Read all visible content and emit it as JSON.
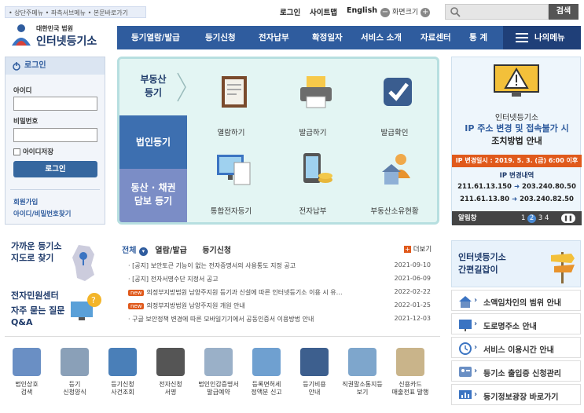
{
  "header": {
    "skip_links": "• 상단주메뉴 • 좌측서브메뉴 • 본문바로가기",
    "login": "로그인",
    "sitemap": "사이트맵",
    "english": "English",
    "zoom_minus": "−",
    "zoom_label": "화면크기",
    "zoom_plus": "+",
    "search_placeholder": "",
    "search_button": "검색",
    "logo_small": "대한민국 법원",
    "logo_main": "인터넷등기소"
  },
  "nav": {
    "items": [
      "등기열람/발급",
      "등기신청",
      "전자납부",
      "확정일자",
      "서비스 소개",
      "자료센터",
      "통 계"
    ],
    "my_menu": "나의메뉴"
  },
  "login_box": {
    "title": "로그인",
    "id_label": "아이디",
    "pw_label": "비밀번호",
    "save_id": "아이디저장",
    "login_button": "로그인",
    "join": "회원가입",
    "find": "아이디/비밀번호찾기"
  },
  "center": {
    "side_tabs": [
      "부동산\n등기",
      "법인등기",
      "동산 · 채권\n담보 등기"
    ],
    "tiles": [
      "열람하기",
      "발급하기",
      "발급확인",
      "통합전자등기",
      "전자납부",
      "부동산소유현황"
    ]
  },
  "banner": {
    "line1": "인터넷등기소",
    "line2": "IP 주소 변경 및 접속불가 시",
    "line3": "조치방법 안내",
    "date": "IP 변경일시 : 2019. 5. 3. (금) 6:00 이후",
    "detail_title": "IP 변경내역",
    "row1_old": "211.61.13.150",
    "row1_new": "203.240.80.50",
    "row2_old": "211.61.13.80",
    "row2_new": "203.240.82.50",
    "bar_label": "알림창",
    "pages": [
      "1",
      "2",
      "3",
      "4"
    ]
  },
  "guides": {
    "g1_line1": "가까운 등기소",
    "g1_line2": "지도로 찾기",
    "g2_line1": "전자민원센터",
    "g2_line2": "자주 묻는 질문",
    "g2_line3": "Q&A"
  },
  "news": {
    "tabs": [
      "전체",
      "열람/발급",
      "등기신청"
    ],
    "more": "더보기",
    "new_badge": "new",
    "items": [
      {
        "title": "· [공지] 보안토큰 기능이 없는 전자증명서의 사용통도 지정 공고",
        "date": "2021-09-10",
        "new": false
      },
      {
        "title": "· [공지] 전자서명수단 지정서 공고",
        "date": "2021-06-09",
        "new": false
      },
      {
        "title": "의정부지방법원 남양주지원 등기과 신설에 따른 인터넷등기소 이용 시 유…",
        "date": "2022-02-22",
        "new": true
      },
      {
        "title": "의정부지방법원 남양주지원 개원 안내",
        "date": "2022-01-25",
        "new": true
      },
      {
        "title": "· 구글 보안정책 변경에 따른 모바일기기에서 공동인증서 이용방법 안내",
        "date": "2021-12-03",
        "new": false
      }
    ]
  },
  "bottom_icons": [
    {
      "label": "법인상호\n검색",
      "color": "#6a8fc4"
    },
    {
      "label": "등기\n신청양식",
      "color": "#8aa0b8"
    },
    {
      "label": "등기신청\n사건조회",
      "color": "#4a7fb8"
    },
    {
      "label": "전자신청\n서명",
      "color": "#555555"
    },
    {
      "label": "법인인감증명서\n발급예약",
      "color": "#9ab0c8"
    },
    {
      "label": "등록면허세\n정액분 신고",
      "color": "#6fa0d0"
    },
    {
      "label": "등기비용\n안내",
      "color": "#3d5f8e"
    },
    {
      "label": "직권말소통지등\n보기",
      "color": "#7ea6cc"
    },
    {
      "label": "신용카드\n매출전표 발행",
      "color": "#c9b48a"
    }
  ],
  "right_side": {
    "shortcut_title1": "인터넷등기소",
    "shortcut_title2": "간편길잡이",
    "items": [
      "소액임차인의 범위 안내",
      "도로명주소 안내",
      "서비스 이용시간 안내",
      "등기소 출입증 신청관리",
      "등기정보광장 바로가기"
    ]
  }
}
